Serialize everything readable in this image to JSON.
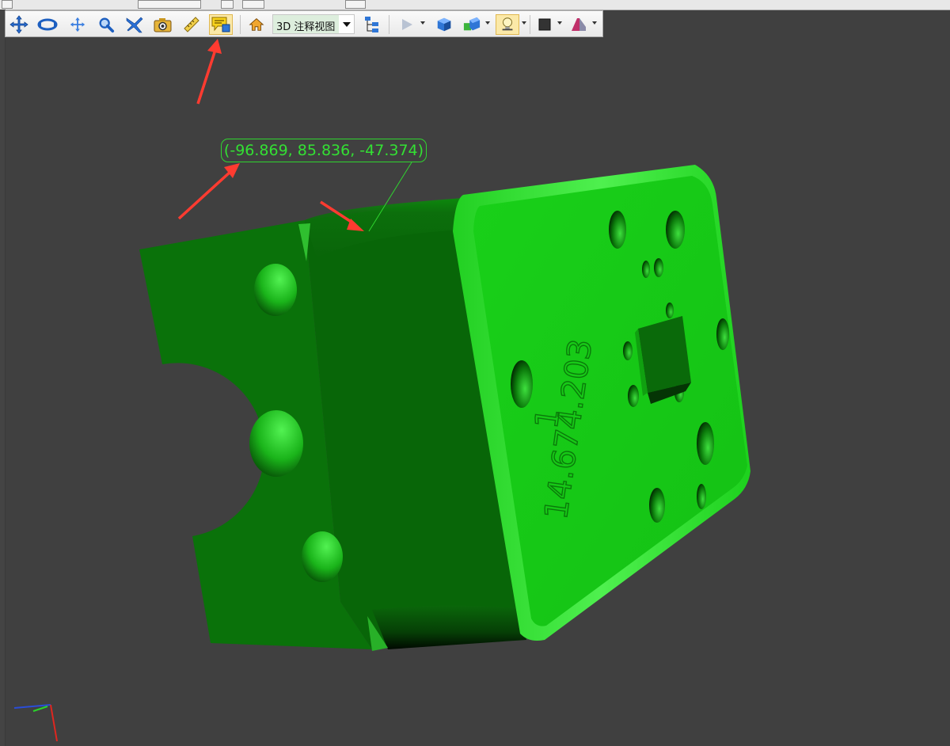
{
  "toolbar": {
    "view_selector": {
      "selected": "3D 注释视图"
    },
    "icons": [
      "pan-move-icon",
      "rotate-icon",
      "move-icon",
      "zoom-icon",
      "fly-icon",
      "snapshot-camera-icon",
      "measure-ruler-icon",
      "annotation-comment-icon",
      "home-view-icon",
      "view-tree-icon",
      "play-icon",
      "solid-cube-icon",
      "render-mode-icon",
      "lighting-icon",
      "background-color-icon",
      "cross-section-icon"
    ],
    "active_tool": "annotation-comment-icon"
  },
  "viewport": {
    "annotation": {
      "text": "(-96.869, 85.836, -47.374)"
    },
    "part_engraving": {
      "line1": "1",
      "line2": "14.674.203"
    },
    "colors": {
      "background": "#404040",
      "part": "#11c811",
      "annotation": "#33e033",
      "arrow": "#ff3b30"
    }
  }
}
